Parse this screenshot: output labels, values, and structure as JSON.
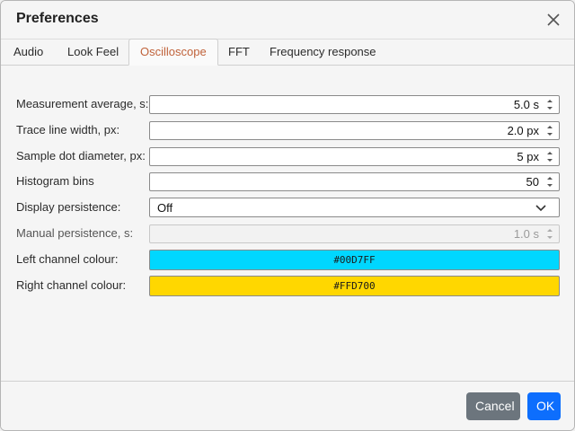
{
  "dialog": {
    "title": "Preferences",
    "close_icon": "close-icon"
  },
  "tabs": [
    {
      "label": "Audio",
      "active": false
    },
    {
      "label": "Look Feel",
      "active": false
    },
    {
      "label": "Oscilloscope",
      "active": true
    },
    {
      "label": "FFT",
      "active": false
    },
    {
      "label": "Frequency response",
      "active": false
    }
  ],
  "settings": {
    "measurement_average": {
      "label": "Measurement average, s:",
      "value": "5.0 s"
    },
    "trace_line_width": {
      "label": "Trace line width, px:",
      "value": "2.0 px"
    },
    "sample_dot_diameter": {
      "label": "Sample dot diameter, px:",
      "value": "5 px"
    },
    "histogram_bins": {
      "label": "Histogram bins",
      "value": "50"
    },
    "display_persistence": {
      "label": "Display persistence:",
      "value": "Off"
    },
    "manual_persistence": {
      "label": "Manual persistence, s:",
      "value": "1.0 s",
      "disabled": true
    },
    "left_channel_colour": {
      "label": "Left channel colour:",
      "value": "#00D7FF"
    },
    "right_channel_colour": {
      "label": "Right channel colour:",
      "value": "#FFD700"
    }
  },
  "footer": {
    "cancel_label": "Cancel",
    "ok_label": "OK"
  },
  "colors": {
    "tab_active_text": "#c0623a",
    "cancel_bg": "#6c757d",
    "ok_bg": "#0d6efd"
  }
}
